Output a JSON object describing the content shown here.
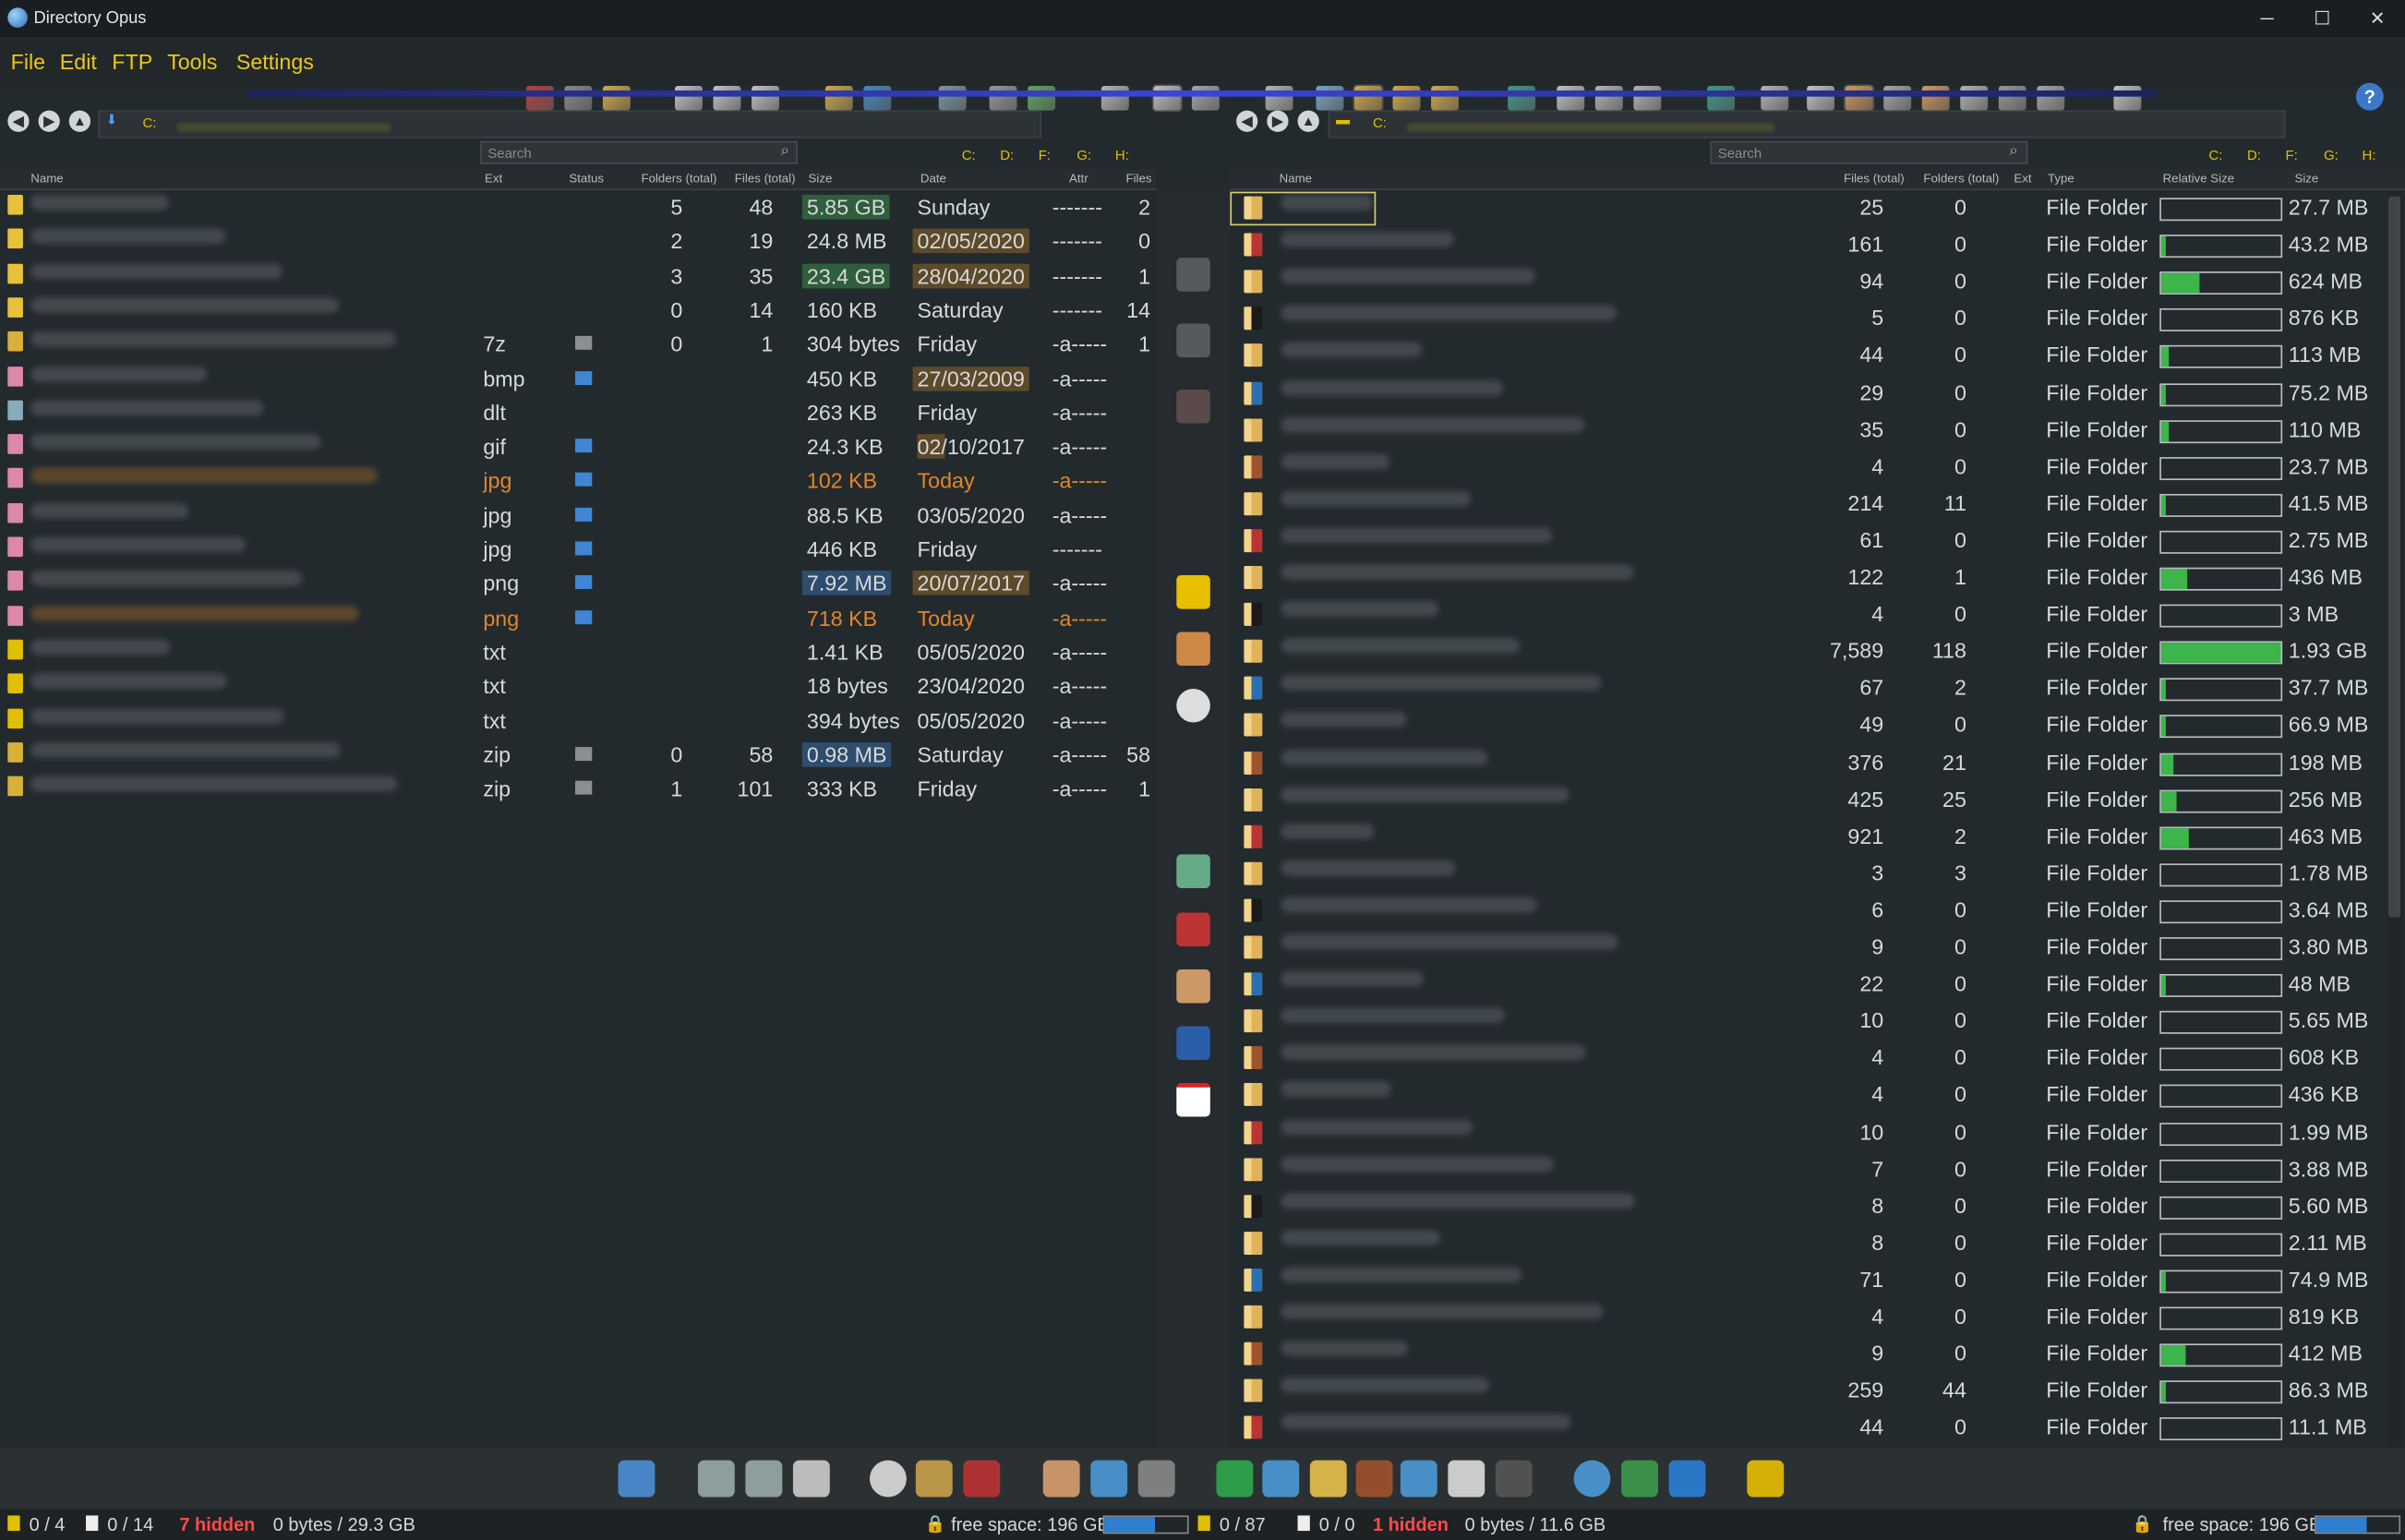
{
  "window": {
    "title": "Directory Opus",
    "controls": {
      "minimize": "─",
      "maximize": "☐",
      "close": "✕"
    }
  },
  "menu": [
    "File",
    "Edit",
    "FTP",
    "Tools",
    "Settings"
  ],
  "help_label": "?",
  "left": {
    "path": [
      "C:"
    ],
    "search_placeholder": "Search",
    "drives": [
      "C:",
      "D:",
      "F:",
      "G:",
      "H:"
    ],
    "columns": {
      "name": "Name",
      "ext": "Ext",
      "status": "Status",
      "folders": "Folders (total)",
      "files": "Files (total)",
      "size": "Size",
      "date": "Date",
      "attr": "Attr",
      "files2": "Files"
    },
    "rows": [
      {
        "kind": "folder",
        "ext": "",
        "folders": "5",
        "files": "48",
        "size": "5.85 GB",
        "date": "Sunday",
        "attr": "-------",
        "files2": "2",
        "size_hl": "green",
        "date_hl": ""
      },
      {
        "kind": "folder",
        "ext": "",
        "folders": "2",
        "files": "19",
        "size": "24.8 MB",
        "date": "02/05/2020",
        "attr": "-------",
        "files2": "0",
        "size_hl": "",
        "date_hl": "tan"
      },
      {
        "kind": "folder",
        "ext": "",
        "folders": "3",
        "files": "35",
        "size": "23.4 GB",
        "date": "28/04/2020",
        "attr": "-------",
        "files2": "1",
        "size_hl": "green",
        "date_hl": "tan"
      },
      {
        "kind": "folder",
        "ext": "",
        "folders": "0",
        "files": "14",
        "size": "160 KB",
        "date": "Saturday",
        "attr": "-------",
        "files2": "14",
        "size_hl": "",
        "date_hl": ""
      },
      {
        "kind": "archive",
        "ext": "7z",
        "folders": "0",
        "files": "1",
        "size": "304 bytes",
        "date": "Friday",
        "attr": "-a-----",
        "files2": "1",
        "size_hl": "",
        "date_hl": ""
      },
      {
        "kind": "image",
        "ext": "bmp",
        "folders": "",
        "files": "",
        "size": "450 KB",
        "date": "27/03/2009",
        "attr": "-a-----",
        "files2": "",
        "size_hl": "",
        "date_hl": "tan"
      },
      {
        "kind": "file",
        "ext": "dlt",
        "folders": "",
        "files": "",
        "size": "263 KB",
        "date": "Friday",
        "attr": "-a-----",
        "files2": "",
        "size_hl": "",
        "date_hl": ""
      },
      {
        "kind": "image",
        "ext": "gif",
        "folders": "",
        "files": "",
        "size": "24.3 KB",
        "date": "02/10/2017",
        "attr": "-a-----",
        "files2": "",
        "size_hl": "",
        "date_hl": "tan-partial"
      },
      {
        "kind": "image-orange",
        "ext": "jpg",
        "folders": "",
        "files": "",
        "size": "102 KB",
        "date": "Today",
        "attr": "-a-----",
        "files2": "",
        "size_hl": "",
        "date_hl": "",
        "orange": true
      },
      {
        "kind": "image",
        "ext": "jpg",
        "folders": "",
        "files": "",
        "size": "88.5 KB",
        "date": "03/05/2020",
        "attr": "-a-----",
        "files2": "",
        "size_hl": "",
        "date_hl": ""
      },
      {
        "kind": "image",
        "ext": "jpg",
        "folders": "",
        "files": "",
        "size": "446 KB",
        "date": "Friday",
        "attr": "-------",
        "files2": "",
        "size_hl": "",
        "date_hl": ""
      },
      {
        "kind": "image",
        "ext": "png",
        "folders": "",
        "files": "",
        "size": "7.92 MB",
        "date": "20/07/2017",
        "attr": "-a-----",
        "files2": "",
        "size_hl": "blue",
        "date_hl": "tan"
      },
      {
        "kind": "image-orange",
        "ext": "png",
        "folders": "",
        "files": "",
        "size": "718 KB",
        "date": "Today",
        "attr": "-a-----",
        "files2": "",
        "size_hl": "",
        "date_hl": "",
        "orange": true
      },
      {
        "kind": "text",
        "ext": "txt",
        "folders": "",
        "files": "",
        "size": "1.41 KB",
        "date": "05/05/2020",
        "attr": "-a-----",
        "files2": "",
        "size_hl": "",
        "date_hl": ""
      },
      {
        "kind": "text",
        "ext": "txt",
        "folders": "",
        "files": "",
        "size": "18 bytes",
        "date": "23/04/2020",
        "attr": "-a-----",
        "files2": "",
        "size_hl": "",
        "date_hl": ""
      },
      {
        "kind": "text",
        "ext": "txt",
        "folders": "",
        "files": "",
        "size": "394 bytes",
        "date": "05/05/2020",
        "attr": "-a-----",
        "files2": "",
        "size_hl": "",
        "date_hl": ""
      },
      {
        "kind": "archive",
        "ext": "zip",
        "folders": "0",
        "files": "58",
        "size": "0.98 MB",
        "date": "Saturday",
        "attr": "-a-----",
        "files2": "58",
        "size_hl": "blue",
        "date_hl": ""
      },
      {
        "kind": "archive",
        "ext": "zip",
        "folders": "1",
        "files": "101",
        "size": "333 KB",
        "date": "Friday",
        "attr": "-a-----",
        "files2": "1",
        "size_hl": "",
        "date_hl": ""
      }
    ]
  },
  "right": {
    "path": [
      "C:"
    ],
    "search_placeholder": "Search",
    "drives": [
      "C:",
      "D:",
      "F:",
      "G:",
      "H:"
    ],
    "columns": {
      "name": "Name",
      "files": "Files (total)",
      "folders": "Folders (total)",
      "ext": "Ext",
      "type": "Type",
      "rel": "Relative Size",
      "size": "Size"
    },
    "rows": [
      {
        "files": "25",
        "folders": "0",
        "type": "File Folder",
        "size": "27.7 MB",
        "rel": 0.0
      },
      {
        "files": "161",
        "folders": "0",
        "type": "File Folder",
        "size": "43.2 MB",
        "rel": 0.02
      },
      {
        "files": "94",
        "folders": "0",
        "type": "File Folder",
        "size": "624 MB",
        "rel": 0.32
      },
      {
        "files": "5",
        "folders": "0",
        "type": "File Folder",
        "size": "876 KB",
        "rel": 0.0
      },
      {
        "files": "44",
        "folders": "0",
        "type": "File Folder",
        "size": "113 MB",
        "rel": 0.06
      },
      {
        "files": "29",
        "folders": "0",
        "type": "File Folder",
        "size": "75.2 MB",
        "rel": 0.04
      },
      {
        "files": "35",
        "folders": "0",
        "type": "File Folder",
        "size": "110 MB",
        "rel": 0.06
      },
      {
        "files": "4",
        "folders": "0",
        "type": "File Folder",
        "size": "23.7 MB",
        "rel": 0.0
      },
      {
        "files": "214",
        "folders": "11",
        "type": "File Folder",
        "size": "41.5 MB",
        "rel": 0.02
      },
      {
        "files": "61",
        "folders": "0",
        "type": "File Folder",
        "size": "2.75 MB",
        "rel": 0.0
      },
      {
        "files": "122",
        "folders": "1",
        "type": "File Folder",
        "size": "436 MB",
        "rel": 0.22
      },
      {
        "files": "4",
        "folders": "0",
        "type": "File Folder",
        "size": "3 MB",
        "rel": 0.0
      },
      {
        "files": "7,589",
        "folders": "118",
        "type": "File Folder",
        "size": "1.93 GB",
        "rel": 1.0
      },
      {
        "files": "67",
        "folders": "2",
        "type": "File Folder",
        "size": "37.7 MB",
        "rel": 0.02
      },
      {
        "files": "49",
        "folders": "0",
        "type": "File Folder",
        "size": "66.9 MB",
        "rel": 0.03
      },
      {
        "files": "376",
        "folders": "21",
        "type": "File Folder",
        "size": "198 MB",
        "rel": 0.1
      },
      {
        "files": "425",
        "folders": "25",
        "type": "File Folder",
        "size": "256 MB",
        "rel": 0.13
      },
      {
        "files": "921",
        "folders": "2",
        "type": "File Folder",
        "size": "463 MB",
        "rel": 0.23
      },
      {
        "files": "3",
        "folders": "3",
        "type": "File Folder",
        "size": "1.78 MB",
        "rel": 0.0
      },
      {
        "files": "6",
        "folders": "0",
        "type": "File Folder",
        "size": "3.64 MB",
        "rel": 0.0
      },
      {
        "files": "9",
        "folders": "0",
        "type": "File Folder",
        "size": "3.80 MB",
        "rel": 0.0
      },
      {
        "files": "22",
        "folders": "0",
        "type": "File Folder",
        "size": "48 MB",
        "rel": 0.02
      },
      {
        "files": "10",
        "folders": "0",
        "type": "File Folder",
        "size": "5.65 MB",
        "rel": 0.0
      },
      {
        "files": "4",
        "folders": "0",
        "type": "File Folder",
        "size": "608 KB",
        "rel": 0.0
      },
      {
        "files": "4",
        "folders": "0",
        "type": "File Folder",
        "size": "436 KB",
        "rel": 0.0
      },
      {
        "files": "10",
        "folders": "0",
        "type": "File Folder",
        "size": "1.99 MB",
        "rel": 0.0
      },
      {
        "files": "7",
        "folders": "0",
        "type": "File Folder",
        "size": "3.88 MB",
        "rel": 0.0
      },
      {
        "files": "8",
        "folders": "0",
        "type": "File Folder",
        "size": "5.60 MB",
        "rel": 0.0
      },
      {
        "files": "8",
        "folders": "0",
        "type": "File Folder",
        "size": "2.11 MB",
        "rel": 0.0
      },
      {
        "files": "71",
        "folders": "0",
        "type": "File Folder",
        "size": "74.9 MB",
        "rel": 0.04
      },
      {
        "files": "4",
        "folders": "0",
        "type": "File Folder",
        "size": "819 KB",
        "rel": 0.0
      },
      {
        "files": "9",
        "folders": "0",
        "type": "File Folder",
        "size": "412 MB",
        "rel": 0.21
      },
      {
        "files": "259",
        "folders": "44",
        "type": "File Folder",
        "size": "86.3 MB",
        "rel": 0.04
      },
      {
        "files": "44",
        "folders": "0",
        "type": "File Folder",
        "size": "11.1 MB",
        "rel": 0.0
      }
    ]
  },
  "status": {
    "left_dirs": "0 / 4",
    "left_files": "0 / 14",
    "left_hidden": "7 hidden",
    "left_bytes": "0 bytes / 29.3 GB",
    "left_free": "free space: 196 GB",
    "left_free_fill": 0.62,
    "right_dirs": "0 / 87",
    "right_files": "0 / 0",
    "right_hidden": "1 hidden",
    "right_bytes": "0 bytes / 11.6 GB",
    "right_free": "free space: 196 GB",
    "right_free_fill": 0.62
  },
  "colors": {
    "menu": "#e8c81c",
    "green_bar": "#3cb54a",
    "orange_text": "#e0862a",
    "hidden_red": "#ff4a4a",
    "accent_blue": "#2f7fd1"
  },
  "icons": {
    "toolbar": [
      "delete-icon",
      "copy-icon",
      "paste-icon",
      "layout-dual-icon",
      "layout-single-icon",
      "layout-tree-icon",
      "find-icon",
      "globe-icon",
      "view-mode-icon",
      "view-details-icon",
      "thumbnails-icon",
      "checkbox-mode-icon",
      "layout-a-icon",
      "layout-b-icon",
      "layout-c-icon",
      "layout-d-icon",
      "new-folder-icon",
      "user-folder-icon",
      "favorites-icon",
      "slideshow-icon",
      "columns-icon",
      "pane-icon",
      "settings-icon",
      "viewer-icon",
      "checklist-icon",
      "list-icon",
      "rename-icon",
      "select-icon",
      "tiles-icon",
      "swap-icon"
    ],
    "midbar": [
      "copy-to-icon",
      "move-to-icon",
      "delete-x-icon",
      "player-icon",
      "check-icon",
      "disc-icon",
      "library-icon",
      "s-icon",
      "book-icon",
      "clipboard-icon",
      "pdf-icon"
    ],
    "bottombar": [
      "monitor-icon",
      "drive-a-icon",
      "drive-b-icon",
      "drive-c-icon",
      "film-icon",
      "4k-icon",
      "tv-icon",
      "user-icon",
      "picture-icon",
      "recycle-icon",
      "download-icon",
      "photos-icon",
      "sunflower-icon",
      "books-icon",
      "music-icon",
      "document-icon",
      "camera-icon",
      "onedrive-icon",
      "gdrive-icon",
      "dropbox-icon",
      "star-icon"
    ]
  }
}
